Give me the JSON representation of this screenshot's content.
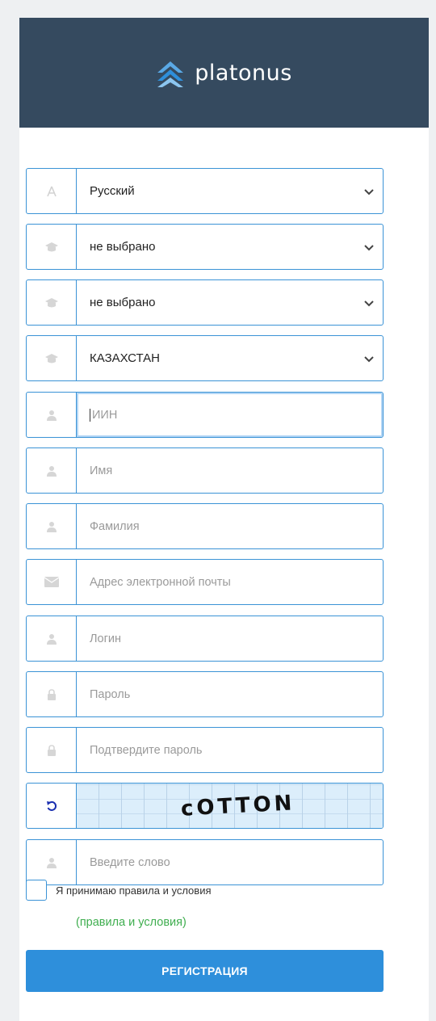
{
  "app": {
    "brand": "platonus"
  },
  "form": {
    "language": {
      "value": "Русский",
      "icon": "font-icon"
    },
    "select_1": {
      "value": "не выбрано",
      "icon": "graduation-cap-icon"
    },
    "select_2": {
      "value": "не выбрано",
      "icon": "graduation-cap-icon"
    },
    "country": {
      "value": "КАЗАХСТАН",
      "icon": "graduation-cap-icon"
    },
    "iin": {
      "placeholder": "ИИН",
      "icon": "user-icon"
    },
    "first_name": {
      "placeholder": "Имя",
      "icon": "user-icon"
    },
    "last_name": {
      "placeholder": "Фамилия",
      "icon": "user-icon"
    },
    "email": {
      "placeholder": "Адрес электронной почты",
      "icon": "envelope-icon"
    },
    "login": {
      "placeholder": "Логин",
      "icon": "user-icon"
    },
    "password": {
      "placeholder": "Пароль",
      "icon": "lock-icon"
    },
    "password_confirm": {
      "placeholder": "Подтвердите пароль",
      "icon": "lock-icon"
    },
    "captcha": {
      "word": "cOTTON",
      "icon": "refresh-icon"
    },
    "captcha_input": {
      "placeholder": "Введите слово",
      "icon": "user-icon"
    },
    "terms_label": "Я принимаю правила и условия",
    "terms_link": "(правила и условия)",
    "submit_label": "РЕГИСТРАЦИЯ"
  },
  "colors": {
    "header": "#354a5f",
    "accent": "#2e8fdb",
    "field_border": "#3b93d6",
    "link": "#3fae4f"
  }
}
